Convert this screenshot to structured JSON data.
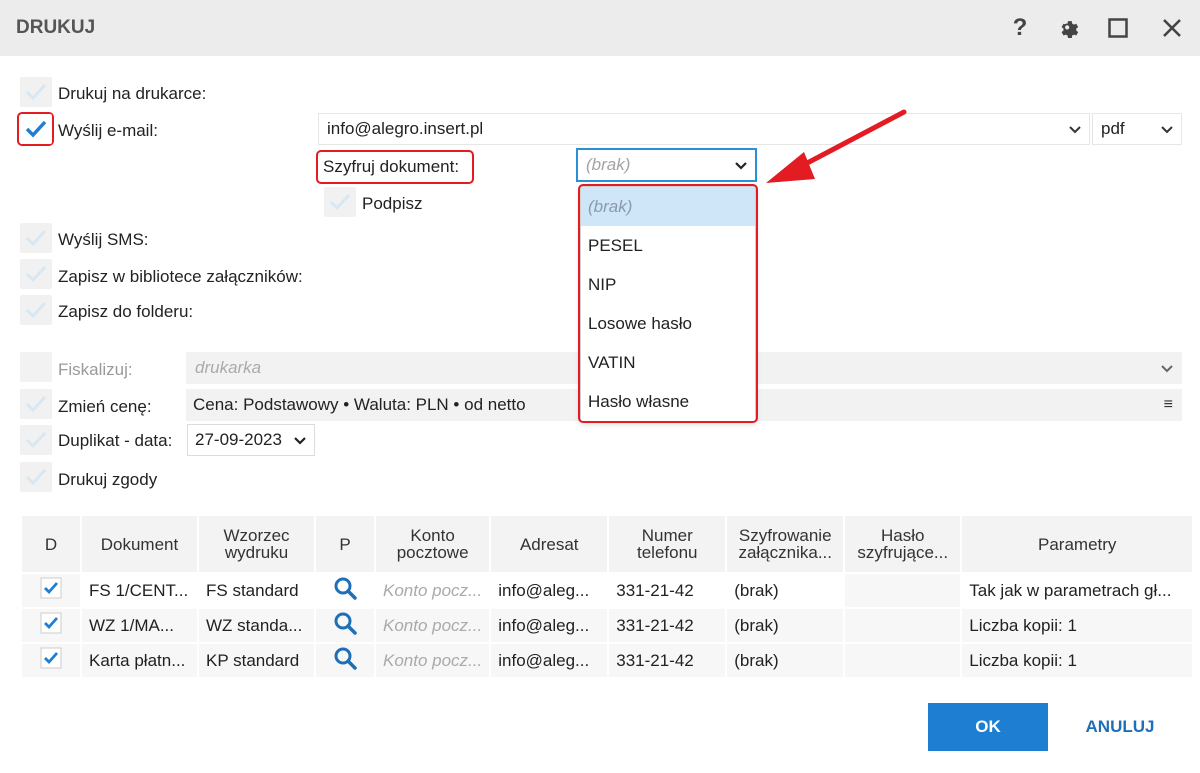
{
  "window": {
    "title": "DRUKUJ"
  },
  "options": {
    "print_label": "Drukuj na drukarce:",
    "email_label": "Wyślij e-mail:",
    "email_value": "info@alegro.insert.pl",
    "format_value": "pdf",
    "encrypt_label": "Szyfruj dokument:",
    "encrypt_value": "(brak)",
    "sign_label": "Podpisz",
    "sms_label": "Wyślij SMS:",
    "library_label": "Zapisz w bibliotece załączników:",
    "folder_label": "Zapisz do folderu:",
    "fiscal_label": "Fiskalizuj:",
    "fiscal_placeholder": "drukarka",
    "price_label": "Zmień cenę:",
    "price_value": "Cena: Podstawowy • Waluta: PLN • od netto",
    "duplicate_label": "Duplikat - data:",
    "duplicate_value": "27-09-2023",
    "consent_label": "Drukuj zgody"
  },
  "encrypt_dropdown": {
    "options": [
      "(brak)",
      "PESEL",
      "NIP",
      "Losowe hasło",
      "VATIN",
      "Hasło własne"
    ]
  },
  "table": {
    "headers": [
      "D",
      "Dokument",
      "Wzorzec wydruku",
      "P",
      "Konto pocztowe",
      "Adresat",
      "Numer telefonu",
      "Szyfrowanie załącznika...",
      "Hasło szyfrujące...",
      "Parametry"
    ],
    "rows": [
      {
        "doc": "FS 1/CENT...",
        "template": "FS standard",
        "account": "Konto pocz...",
        "recipient": "info@aleg...",
        "phone": "331-21-42",
        "enc": "(brak)",
        "pass": "",
        "params": "Tak jak w parametrach gł..."
      },
      {
        "doc": "WZ 1/MA...",
        "template": "WZ standa...",
        "account": "Konto pocz...",
        "recipient": "info@aleg...",
        "phone": "331-21-42",
        "enc": "(brak)",
        "pass": "",
        "params": "Liczba kopii: 1"
      },
      {
        "doc": "Karta płatn...",
        "template": "KP standard",
        "account": "Konto pocz...",
        "recipient": "info@aleg...",
        "phone": "331-21-42",
        "enc": "(brak)",
        "pass": "",
        "params": "Liczba kopii: 1"
      }
    ]
  },
  "buttons": {
    "ok": "OK",
    "cancel": "ANULUJ"
  },
  "colors": {
    "accent": "#1e7fd2",
    "highlight": "#e31b23",
    "check": "#1e7fd2"
  }
}
